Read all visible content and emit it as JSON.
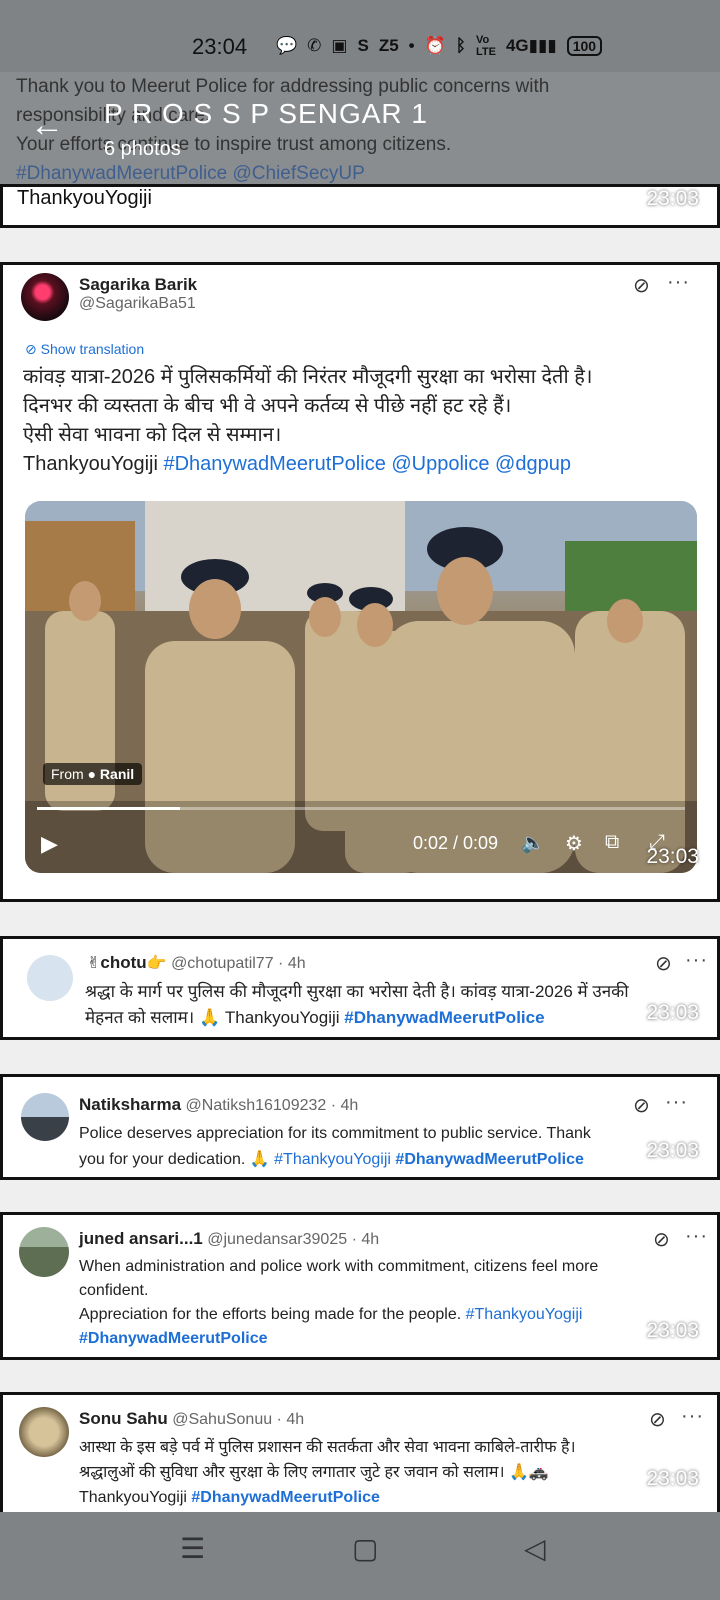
{
  "status": {
    "time": "23:04",
    "icons": [
      "chat-bubble-icon",
      "whatsapp-icon",
      "sonyliv-icon",
      "s-icon",
      "z5-icon",
      "dot-icon",
      "alarm-icon",
      "bluetooth-icon",
      "volte-icon",
      "4g-signal-icon"
    ],
    "battery": "100"
  },
  "header": {
    "title": "P R O S S P SENGAR 1",
    "subtitle": "6 photos",
    "bg_line1": "Thank you to Meerut Police for addressing public concerns with",
    "bg_line2": "responsibility and care.",
    "bg_line3": "Your efforts continue to inspire trust among citizens.",
    "bg_tags": "#DhanywadMeerutPolice @ChiefSecyUP"
  },
  "stamp_time": "23:03",
  "posts": [
    {
      "partial": "ThankyouYogiji"
    },
    {
      "name": "Sagarika Barik",
      "handle": "@SagarikaBa51",
      "show_translation": "Show translation",
      "line1": "कांवड़ यात्रा-2026 में पुलिसकर्मियों की निरंतर मौजूदगी सुरक्षा का भरोसा देती है।",
      "line2": "दिनभर की व्यस्तता के बीच भी वे अपने कर्तव्य से पीछे नहीं हट रहे हैं।",
      "line3": "ऐसी सेवा भावना को दिल से सम्मान।",
      "line4_plain": "ThankyouYogiji ",
      "line4_links": "#DhanywadMeerutPolice @Uppolice @dgpup",
      "video": {
        "from_label": "From",
        "from_name": "Ranil",
        "time": "0:02 / 0:09",
        "progress": 0.22
      }
    },
    {
      "name": "chotu",
      "handle": "@chotupatil77 · 4h",
      "line1": "श्रद्धा के मार्ग पर पुलिस की मौजूदगी सुरक्षा का भरोसा देती है। कांवड़ यात्रा-2026 में उनकी",
      "line2_plain": "मेहनत को सलाम। 🙏 ThankyouYogiji ",
      "line2_link": "#DhanywadMeerutPolice"
    },
    {
      "name": "Natiksharma",
      "handle": "@Natiksh16109232 · 4h",
      "line1": "Police deserves appreciation for its commitment to public service. Thank",
      "line2_plain": "you for your dedication. 🙏 ",
      "line2_link1": "#ThankyouYogiji",
      "line2_link2": "#DhanywadMeerutPolice"
    },
    {
      "name": "juned ansari...1",
      "handle": "@junedansar39025 · 4h",
      "line1": "When administration and police work with commitment, citizens feel more",
      "line2": "confident.",
      "line3_plain": "Appreciation for the efforts being made for the people. ",
      "line3_link": "#ThankyouYogiji",
      "line4_link": "#DhanywadMeerutPolice"
    },
    {
      "name": "Sonu Sahu",
      "handle": "@SahuSonuu · 4h",
      "line1": "आस्था के इस बड़े पर्व में पुलिस प्रशासन की सतर्कता और सेवा भावना काबिले-तारीफ है।",
      "line2": "श्रद्धालुओं की सुविधा और सुरक्षा के लिए लगातार जुटे हर जवान को सलाम। 🙏🚓",
      "line3_plain": "ThankyouYogiji ",
      "line3_link": "#DhanywadMeerutPolice"
    }
  ]
}
